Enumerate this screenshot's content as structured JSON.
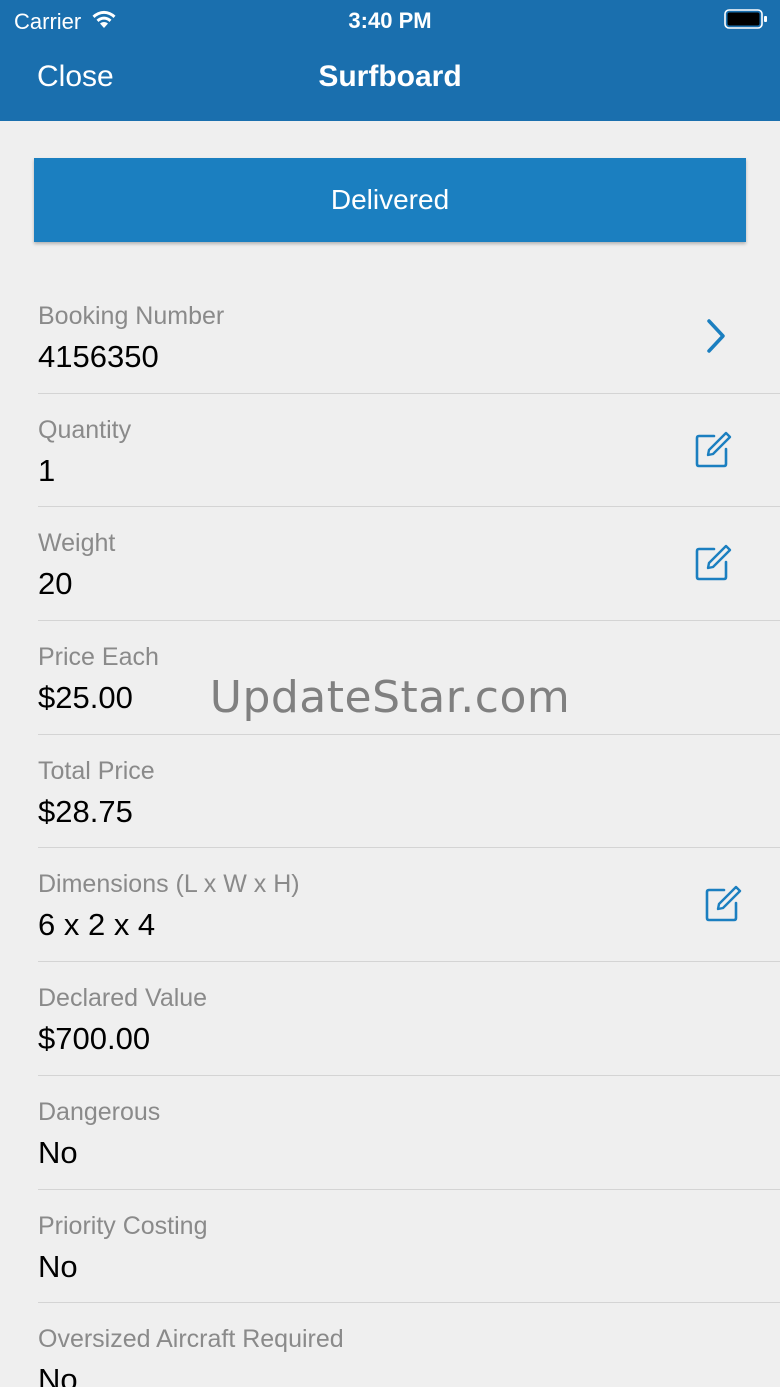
{
  "status_bar": {
    "carrier": "Carrier",
    "time": "3:40 PM"
  },
  "nav": {
    "close_label": "Close",
    "title": "Surfboard"
  },
  "banner": {
    "label": "Delivered"
  },
  "fields": [
    {
      "label": "Booking Number",
      "value": "4156350",
      "action": "chevron-right-icon"
    },
    {
      "label": "Quantity",
      "value": "1",
      "action": "edit-icon"
    },
    {
      "label": "Weight",
      "value": "20",
      "action": "edit-icon"
    },
    {
      "label": "Price Each",
      "value": "$25.00",
      "action": null
    },
    {
      "label": "Total Price",
      "value": "$28.75",
      "action": null
    },
    {
      "label": "Dimensions (L x W x H)",
      "value": "6 x 2 x 4",
      "action": "edit-icon"
    },
    {
      "label": "Declared Value",
      "value": "$700.00",
      "action": null
    },
    {
      "label": "Dangerous",
      "value": "No",
      "action": null
    },
    {
      "label": "Priority Costing",
      "value": "No",
      "action": null
    },
    {
      "label": "Oversized Aircraft Required",
      "value": "No",
      "action": null
    }
  ],
  "watermark": "UpdateStar.com",
  "colors": {
    "nav_bar": "#1a6fae",
    "banner": "#1b7fc0",
    "accent": "#1b7fc0",
    "background": "#efefef"
  }
}
